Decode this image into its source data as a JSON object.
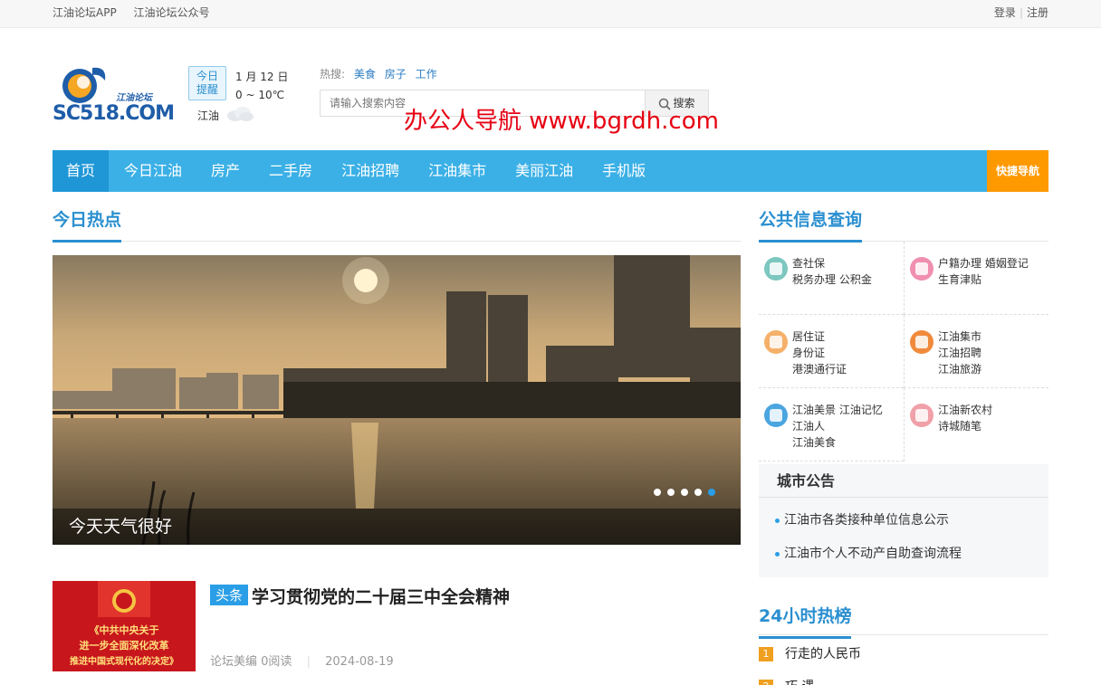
{
  "topbar": {
    "links": [
      "江油论坛APP",
      "江油论坛公众号"
    ],
    "login": "登录",
    "register": "注册"
  },
  "header": {
    "logo_brand": "SC518.COM",
    "logo_sub": "江油论坛",
    "remind_line1": "今日",
    "remind_line2": "提醒",
    "date": "1 月 12 日",
    "temp": "0 ~ 10℃",
    "city": "江油",
    "hot_label": "热搜:",
    "hot_words": [
      "美食",
      "房子",
      "工作"
    ],
    "search_placeholder": "请输入搜索内容",
    "search_button": "搜索",
    "watermark": "办公人导航 www.bgrdh.com"
  },
  "nav": {
    "items": [
      "首页",
      "今日江油",
      "房产",
      "二手房",
      "江油招聘",
      "江油集市",
      "美丽江油",
      "手机版"
    ],
    "quick": "快捷导航"
  },
  "hot_today": {
    "title": "今日热点",
    "slide_caption": "今天天气很好",
    "dots_active": 5
  },
  "headline": {
    "tag": "头条",
    "title": "学习贯彻党的二十届三中全会精神",
    "author": "论坛美编",
    "reads": "0阅读",
    "date": "2024-08-19",
    "thumb_lines": [
      "《中共中央关于",
      "进一步全面深化改革",
      "推进中国式现代化的决定》"
    ]
  },
  "public_info": {
    "title": "公共信息查询",
    "cells": [
      {
        "lines": [
          "查社保",
          "税务办理  公积金"
        ],
        "color": "#7cc7c0"
      },
      {
        "lines": [
          "户籍办理  婚姻登记",
          "生育津贴"
        ],
        "color": "#f08fb0"
      },
      {
        "lines": [
          "居住证",
          "身份证",
          "港澳通行证"
        ],
        "color": "#f5b06a"
      },
      {
        "lines": [
          "江油集市",
          "江油招聘",
          "江油旅游"
        ],
        "color": "#f08a3c"
      },
      {
        "lines": [
          "江油美景  江油记忆",
          "江油人",
          "江油美食"
        ],
        "color": "#4aa5e0"
      },
      {
        "lines": [
          "江油新农村",
          "诗城随笔"
        ],
        "color": "#f0a0a8"
      }
    ]
  },
  "notice": {
    "title": "城市公告",
    "items": [
      "江油市各类接种单位信息公示",
      "江油市个人不动产自助查询流程"
    ]
  },
  "rank": {
    "title": "24小时热榜",
    "items": [
      {
        "n": "1",
        "text": "行走的人民币"
      },
      {
        "n": "2",
        "text": "巧 遇"
      }
    ]
  }
}
